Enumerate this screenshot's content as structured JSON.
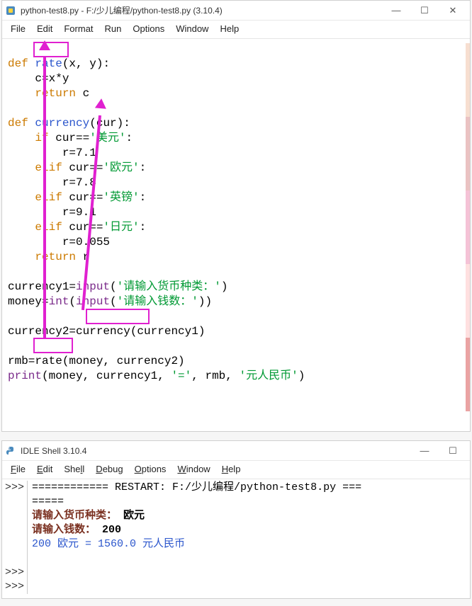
{
  "editor": {
    "title": "python-test8.py - F:/少儿编程/python-test8.py (3.10.4)",
    "menu": [
      "File",
      "Edit",
      "Format",
      "Run",
      "Options",
      "Window",
      "Help"
    ],
    "code": {
      "l1_def": "def",
      "l1_name": "rate",
      "l1_rest": "(x, y):",
      "l2": "    c=x*y",
      "l3_kw": "return",
      "l3_rest": " c",
      "l5_def": "def",
      "l5_name": "currency",
      "l5_rest": "(cur):",
      "l6_kw": "if",
      "l6_mid": " cur==",
      "l6_str": "'美元'",
      "l6_end": ":",
      "l7": "        r=7.1",
      "l8_kw": "elif",
      "l8_mid": " cur==",
      "l8_str": "'欧元'",
      "l8_end": ":",
      "l9": "        r=7.8",
      "l10_kw": "elif",
      "l10_mid": " cur==",
      "l10_str": "'英镑'",
      "l10_end": ":",
      "l11": "        r=9.1",
      "l12_kw": "elif",
      "l12_mid": " cur==",
      "l12_str": "'日元'",
      "l12_end": ":",
      "l13": "        r=0.055",
      "l14_kw": "return",
      "l14_rest": " r",
      "l16_a": "currency1=",
      "l16_fn": "input",
      "l16_p": "(",
      "l16_str": "'请输入货币种类：'",
      "l16_e": ")",
      "l17_a": "money=",
      "l17_int": "int",
      "l17_p": "(",
      "l17_fn": "input",
      "l17_p2": "(",
      "l17_str": "'请输入钱数：'",
      "l17_e": "))",
      "l19_a": "currency2=",
      "l19_fn": "currency",
      "l19_rest": "(currency1)",
      "l21_a": "rmb=",
      "l21_fn": "rate",
      "l21_rest": "(money, currency2)",
      "l22_fn": "print",
      "l22_p": "(money, currency1, ",
      "l22_str1": "'='",
      "l22_m": ", rmb, ",
      "l22_str2": "'元人民币'",
      "l22_e": ")"
    }
  },
  "shell": {
    "title": "IDLE Shell 3.10.4",
    "menu_raw": [
      "File",
      "Edit",
      "Shell",
      "Debug",
      "Options",
      "Window",
      "Help"
    ],
    "gutter": ">>>\n\n\n\n\n\n>>>\n>>>",
    "eq_line": "============",
    "restart": " RESTART: F:/少儿编程/python-test8.py ===",
    "eq_line2": "=====",
    "p1_label": "请输入货币种类：",
    "p1_val": " 欧元",
    "p2_label": "请输入钱数：",
    "p2_val": " 200",
    "out": "200 欧元 = 1560.0 元人民币"
  },
  "win_controls": {
    "min": "—",
    "max": "☐",
    "close": "✕"
  }
}
